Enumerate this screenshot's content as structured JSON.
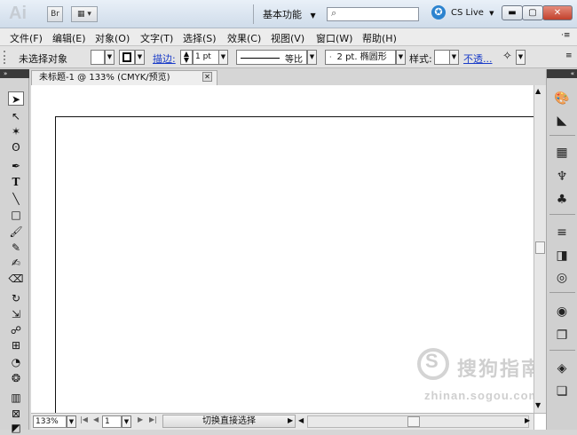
{
  "titlebar": {
    "logo": "Ai",
    "bridge_label": "Br",
    "workspace": "基本功能",
    "search_placeholder": "",
    "cslive": "CS Live"
  },
  "menu": [
    "文件(F)",
    "编辑(E)",
    "对象(O)",
    "文字(T)",
    "选择(S)",
    "效果(C)",
    "视图(V)",
    "窗口(W)",
    "帮助(H)"
  ],
  "controlbar": {
    "selection": "未选择对象",
    "stroke_label": "描边:",
    "stroke_weight": "1 pt",
    "stroke_profile": "等比",
    "brush": "2 pt. 椭圆形",
    "style_label": "样式:",
    "opacity_label": "不透..."
  },
  "document": {
    "tab_title": "未标题-1 @ 133% (CMYK/预览)"
  },
  "statusbar": {
    "zoom": "133%",
    "page": "1",
    "status_text": "切换直接选择"
  },
  "watermark": {
    "main": "搜狗指南",
    "sub": "zhinan.sogou.com"
  },
  "tools": [
    "selection-tool",
    "direct-selection-tool",
    "magic-wand-tool",
    "lasso-tool",
    "pen-tool",
    "type-tool",
    "line-tool",
    "rectangle-tool",
    "paintbrush-tool",
    "pencil-tool",
    "blob-brush-tool",
    "eraser-tool",
    "rotate-tool",
    "scale-tool",
    "warp-tool",
    "free-transform-tool",
    "shape-builder-tool",
    "symbol-sprayer-tool",
    "graph-tool",
    "mesh-tool",
    "gradient-tool"
  ],
  "right_panels": [
    "color-panel",
    "color-guide-panel",
    "swatches-panel",
    "brushes-panel",
    "symbols-panel",
    "stroke-panel",
    "gradient-panel",
    "transparency-panel",
    "appearance-panel",
    "graphic-styles-panel",
    "layers-panel",
    "artboards-panel"
  ]
}
